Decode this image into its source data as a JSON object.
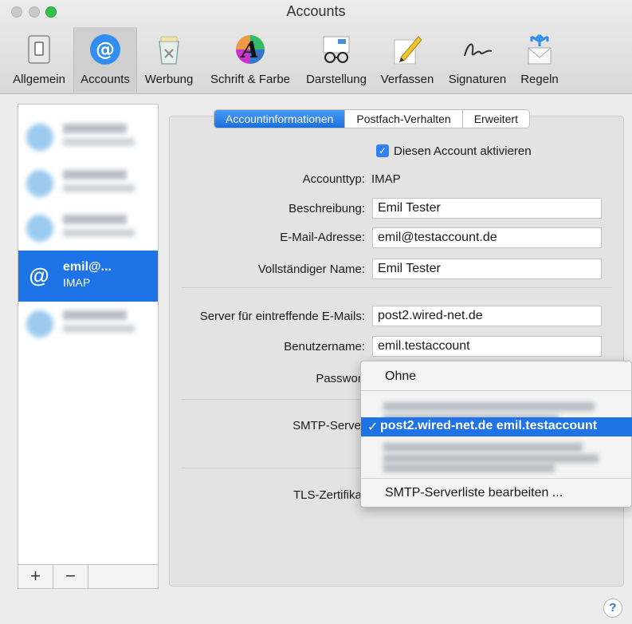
{
  "window": {
    "title": "Accounts"
  },
  "toolbar": {
    "items": [
      {
        "label": "Allgemein",
        "icon": "general-switch-icon"
      },
      {
        "label": "Accounts",
        "icon": "at-sign-icon"
      },
      {
        "label": "Werbung",
        "icon": "junk-trash-icon"
      },
      {
        "label": "Schrift & Farbe",
        "icon": "font-color-icon"
      },
      {
        "label": "Darstellung",
        "icon": "glasses-icon"
      },
      {
        "label": "Verfassen",
        "icon": "pencil-icon"
      },
      {
        "label": "Signaturen",
        "icon": "signature-icon"
      },
      {
        "label": "Regeln",
        "icon": "rules-envelope-icon"
      }
    ]
  },
  "sidebar": {
    "selected_account": {
      "name": "emil@...",
      "type": "IMAP"
    },
    "add_label": "+",
    "remove_label": "−"
  },
  "tabs": [
    "Accountinformationen",
    "Postfach-Verhalten",
    "Erweitert"
  ],
  "form": {
    "enable_label": "Diesen Account aktivieren",
    "account_type_label": "Accounttyp:",
    "account_type_value": "IMAP",
    "description_label": "Beschreibung:",
    "description_value": "Emil Tester",
    "email_label": "E-Mail-Adresse:",
    "email_value": "emil@testaccount.de",
    "fullname_label": "Vollständiger Name:",
    "fullname_value": "Emil Tester",
    "incoming_label": "Server für eintreffende E-Mails:",
    "incoming_value": "post2.wired-net.de",
    "username_label": "Benutzername:",
    "username_value": "emil.testaccount",
    "password_label": "Passwort",
    "smtp_label": "SMTP-Server",
    "tls_label": "TLS-Zertifikat"
  },
  "smtp_popup": {
    "none_option": "Ohne",
    "selected_check": "✓",
    "selected_option": "post2.wired-net.de  emil.testaccount",
    "edit_option": "SMTP-Serverliste bearbeiten ..."
  },
  "help_label": "?",
  "colors": {
    "accent": "#1e74e6",
    "zoom": "#33c048"
  }
}
